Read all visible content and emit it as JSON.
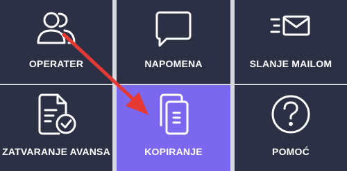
{
  "menu": {
    "tiles": [
      {
        "id": "operater",
        "label": "OPERATER",
        "icon": "users-icon"
      },
      {
        "id": "napomena",
        "label": "NAPOMENA",
        "icon": "speech-bubble-icon"
      },
      {
        "id": "slanje-mailom",
        "label": "SLANJE MAILOM",
        "icon": "envelope-icon"
      },
      {
        "id": "zatvaranje-avansa",
        "label": "ZATVARANJE AVANSA",
        "icon": "document-check-icon"
      },
      {
        "id": "kopiranje",
        "label": "KOPIRANJE",
        "icon": "copy-documents-icon",
        "selected": true
      },
      {
        "id": "pomoc",
        "label": "POMOĆ",
        "icon": "question-circle-icon"
      }
    ]
  },
  "colors": {
    "tile_background": "#2c3044",
    "tile_active_background": "#7b68ee",
    "tile_text": "#ffffff",
    "grid_separator": "#d6d8de",
    "annotation_arrow": "#e53935"
  }
}
